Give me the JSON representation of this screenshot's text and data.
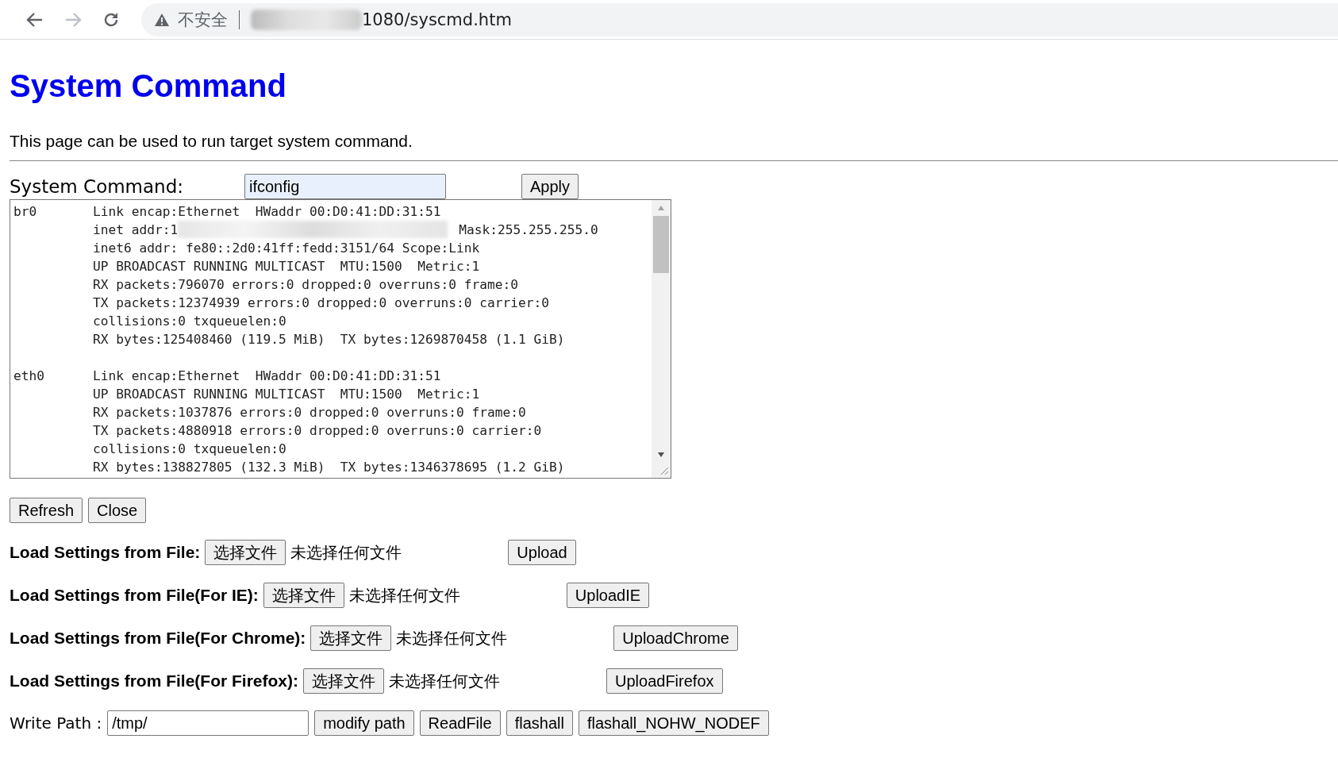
{
  "browser": {
    "security_label": "不安全",
    "url": "1080/syscmd.htm"
  },
  "heading": "System Command",
  "description": "This page can be used to run target system command.",
  "command": {
    "label": "System Command:",
    "value": "ifconfig",
    "button": "Apply"
  },
  "output": {
    "interfaces": [
      {
        "name": "br0",
        "lines": [
          "Link encap:Ethernet  HWaddr 00:D0:41:DD:31:51",
          "inet addr:1",
          "inet6 addr: fe80::2d0:41ff:fedd:3151/64 Scope:Link",
          "UP BROADCAST RUNNING MULTICAST  MTU:1500  Metric:1",
          "RX packets:796070 errors:0 dropped:0 overruns:0 frame:0",
          "TX packets:12374939 errors:0 dropped:0 overruns:0 carrier:0",
          "collisions:0 txqueuelen:0",
          "RX bytes:125408460 (119.5 MiB)  TX bytes:1269870458 (1.1 GiB)"
        ],
        "mask": "Mask:255.255.255.0"
      },
      {
        "name": "eth0",
        "lines": [
          "Link encap:Ethernet  HWaddr 00:D0:41:DD:31:51",
          "UP BROADCAST RUNNING MULTICAST  MTU:1500  Metric:1",
          "RX packets:1037876 errors:0 dropped:0 overruns:0 frame:0",
          "TX packets:4880918 errors:0 dropped:0 overruns:0 carrier:0",
          "collisions:0 txqueuelen:0",
          "RX bytes:138827805 (132.3 MiB)  TX bytes:1346378695 (1.2 GiB)"
        ]
      }
    ]
  },
  "actions": [
    "Refresh",
    "Close"
  ],
  "uploads": [
    {
      "label": "Load Settings from File:",
      "choose": "选择文件",
      "status": "未选择任何文件",
      "button": "Upload"
    },
    {
      "label": "Load Settings from File(For IE):",
      "choose": "选择文件",
      "status": "未选择任何文件",
      "button": "UploadIE"
    },
    {
      "label": "Load Settings from File(For Chrome):",
      "choose": "选择文件",
      "status": "未选择任何文件",
      "button": "UploadChrome"
    },
    {
      "label": "Load Settings from File(For Firefox):",
      "choose": "选择文件",
      "status": "未选择任何文件",
      "button": "UploadFirefox"
    }
  ],
  "write_path": {
    "label": "Write Path :",
    "value": "/tmp/",
    "buttons": [
      "modify path",
      "ReadFile",
      "flashall",
      "flashall_NOHW_NODEF"
    ]
  }
}
